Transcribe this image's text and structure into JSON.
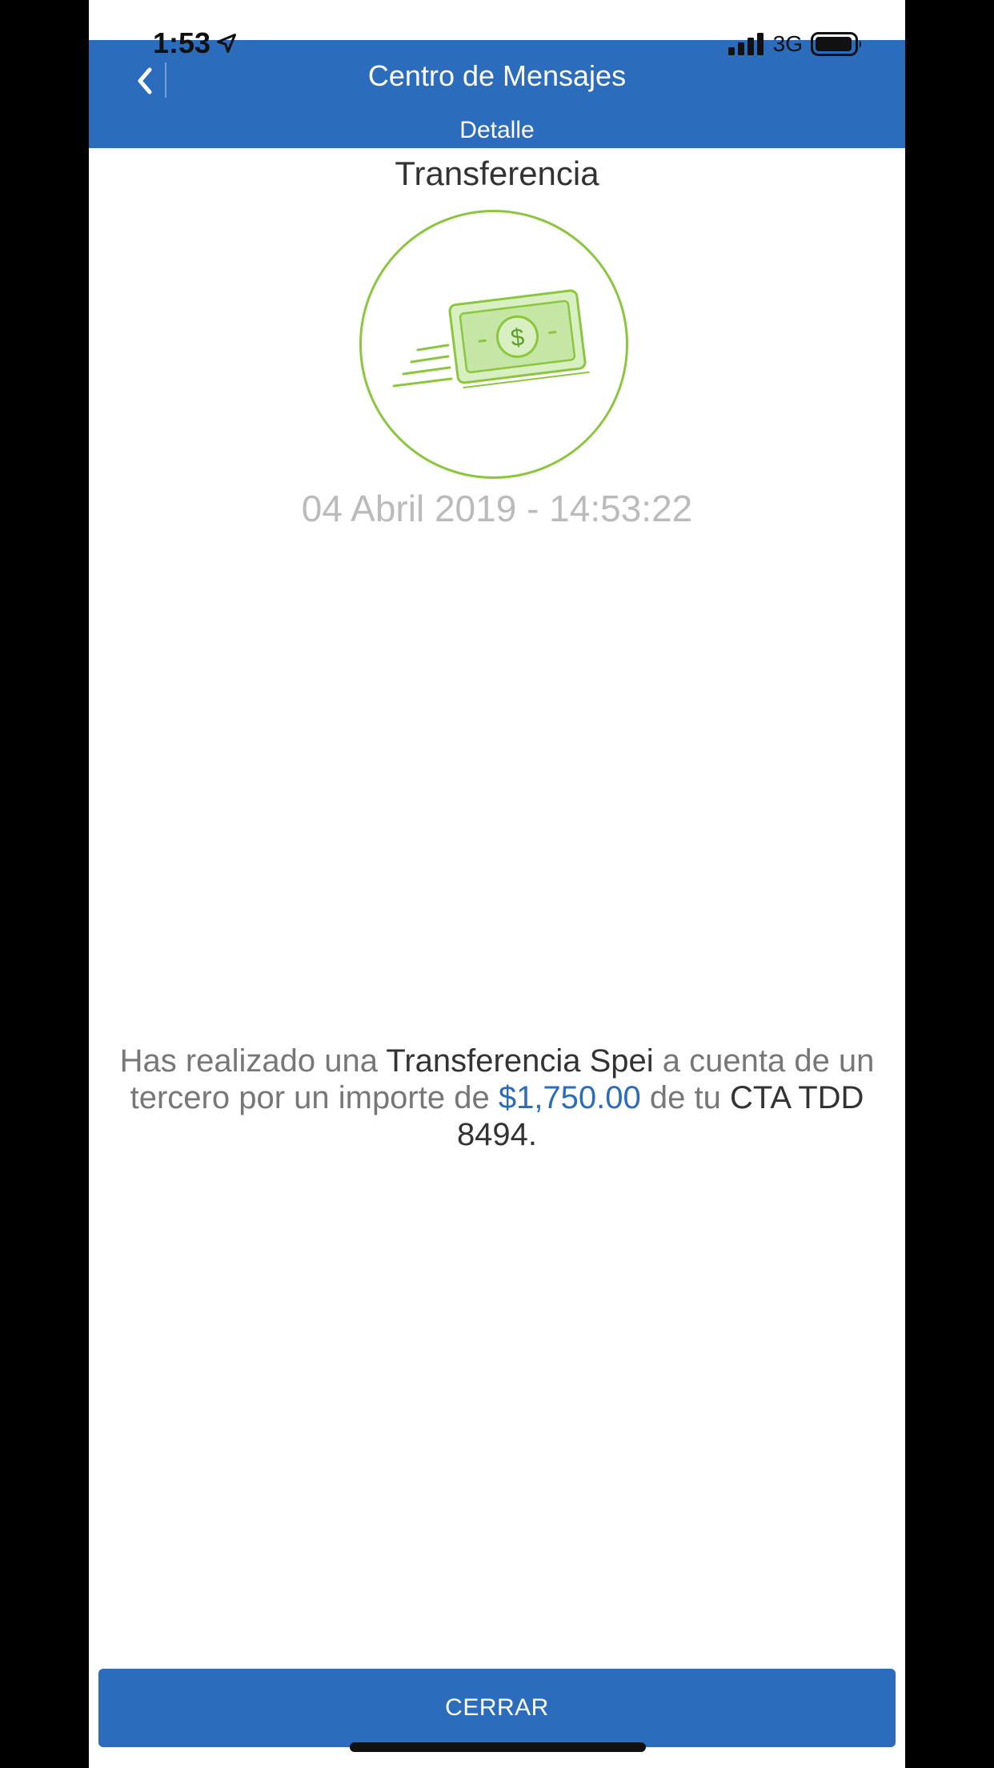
{
  "status_bar": {
    "time": "1:53",
    "network": "3G"
  },
  "header": {
    "title": "Centro de Mensajes",
    "subtitle": "Detalle"
  },
  "message": {
    "title": "Transferencia",
    "date": "04 Abril 2019 - 14:53:22",
    "body": {
      "part1": "Has realizado una ",
      "highlight_type": "Transferencia Spei",
      "part2": " a cuenta de un tercero por un importe de ",
      "amount": "$1,750.00",
      "part3": " de tu ",
      "account": "CTA TDD 8494."
    }
  },
  "footer": {
    "close_label": "CERRAR"
  },
  "colors": {
    "primary": "#2c6cbd",
    "accent_green": "#8cc63f",
    "date_gray": "#bbbbbb"
  },
  "icons": {
    "back": "chevron-left-icon",
    "location": "location-arrow-icon",
    "signal": "signal-bars-icon",
    "battery": "battery-icon",
    "transfer": "money-bill-transfer-icon"
  }
}
